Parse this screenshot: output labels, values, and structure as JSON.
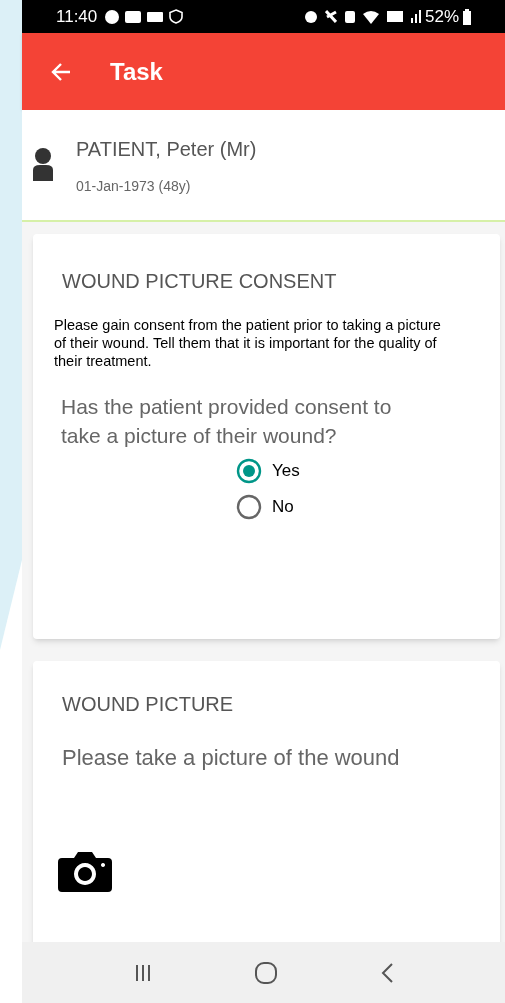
{
  "status_bar": {
    "time": "11:40",
    "battery": "52%"
  },
  "app_bar": {
    "title": "Task"
  },
  "patient": {
    "name": "PATIENT, Peter (Mr)",
    "dob": "01-Jan-1973 (48y)"
  },
  "cards": [
    {
      "kind": "consent",
      "title": "WOUND PICTURE CONSENT",
      "body": "Please gain consent from the patient prior to taking a picture of their wound. Tell them that it is important for the quality of their treatment.",
      "question": "Has the patient provided consent to take a picture of their wound?",
      "options": [
        {
          "label": "Yes",
          "selected": true
        },
        {
          "label": "No",
          "selected": false
        }
      ]
    },
    {
      "kind": "photo",
      "title": "WOUND PICTURE",
      "prompt": "Please take a picture of the wound"
    }
  ]
}
